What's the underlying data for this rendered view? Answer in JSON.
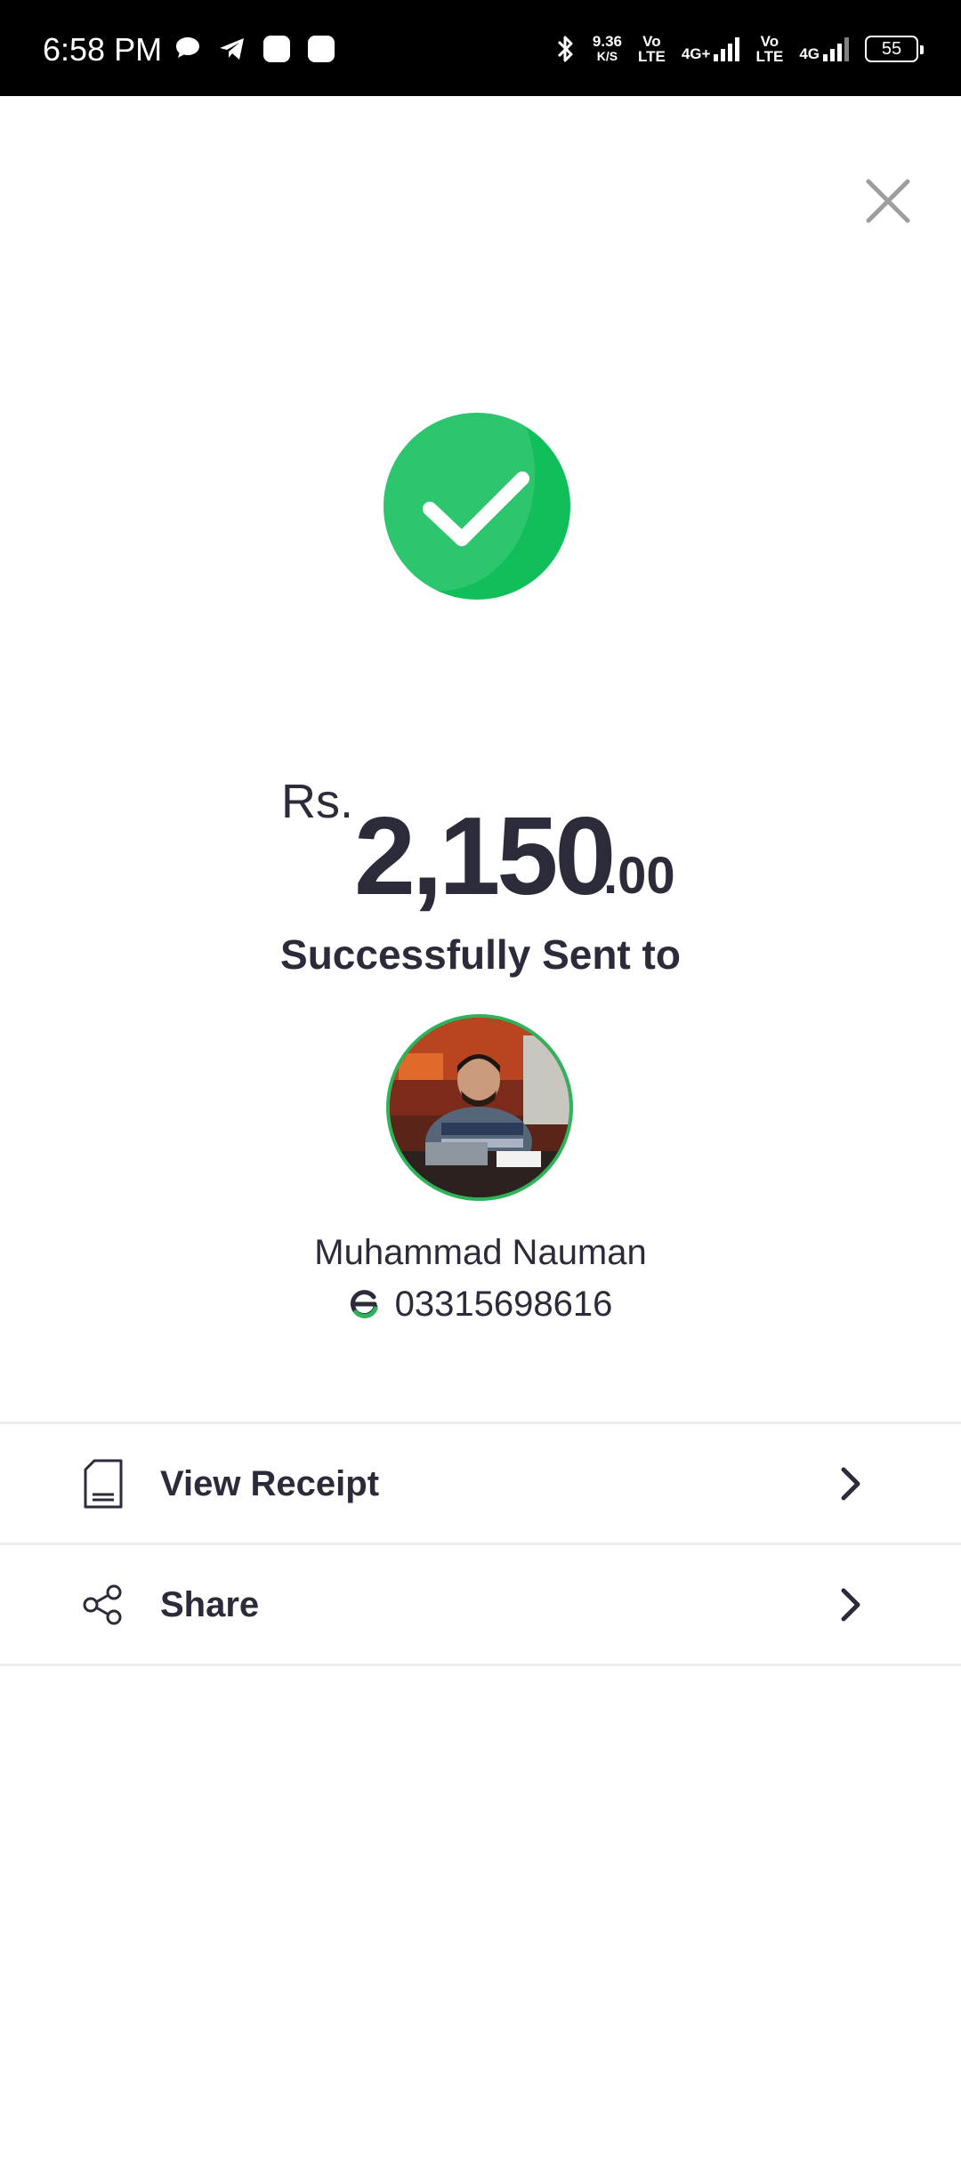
{
  "status_bar": {
    "time": "6:58 PM",
    "app_icons": [
      "chat-bubble-icon",
      "telegram-icon",
      "app-square-icon",
      "app-square-icon"
    ],
    "speed_value": "9.36",
    "speed_unit": "K/S",
    "volte_1_top": "Vo",
    "volte_1_bottom": "LTE",
    "network_1": "4G+",
    "volte_2_top": "Vo",
    "volte_2_bottom": "LTE",
    "network_2": "4G",
    "battery": "55"
  },
  "amount": {
    "currency": "Rs.",
    "main": "2,150",
    "decimal": ".00"
  },
  "status_message": "Successfully Sent to",
  "recipient": {
    "name": "Muhammad Nauman",
    "phone": "03315698616",
    "wallet_icon": "easypaisa-logo-icon"
  },
  "actions": [
    {
      "label": "View Receipt",
      "icon": "receipt-icon"
    },
    {
      "label": "Share",
      "icon": "share-icon"
    }
  ],
  "colors": {
    "success_green": "#10be5a",
    "avatar_ring": "#2fb35a",
    "text_dark": "#2b2b3a",
    "close_gray": "#9e9e9e"
  }
}
